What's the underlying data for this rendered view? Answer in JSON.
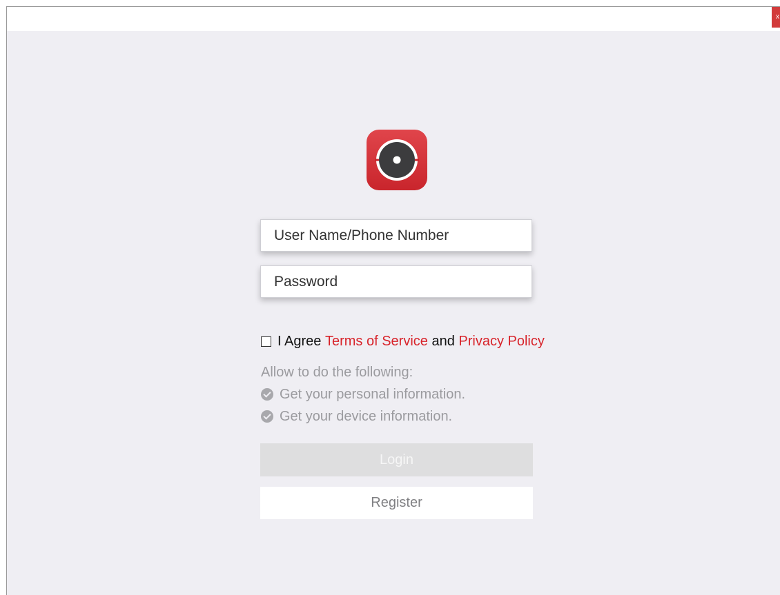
{
  "window": {
    "close_label": "x"
  },
  "login_form": {
    "username_placeholder": "User Name/Phone Number",
    "password_placeholder": "Password",
    "agree": {
      "prefix": "I Agree",
      "terms_label": "Terms of Service",
      "and_text": "and",
      "privacy_label": "Privacy Policy"
    },
    "allow_heading": "Allow to do the following:",
    "permissions": [
      "Get your personal information.",
      "Get your device information."
    ],
    "login_label": "Login",
    "register_label": "Register"
  },
  "colors": {
    "brand_red": "#d8232a",
    "background": "#efeef3",
    "login_disabled_bg": "#dededf"
  },
  "icons": {
    "logo": "camera-lens-icon",
    "permission": "check-circle-icon"
  }
}
